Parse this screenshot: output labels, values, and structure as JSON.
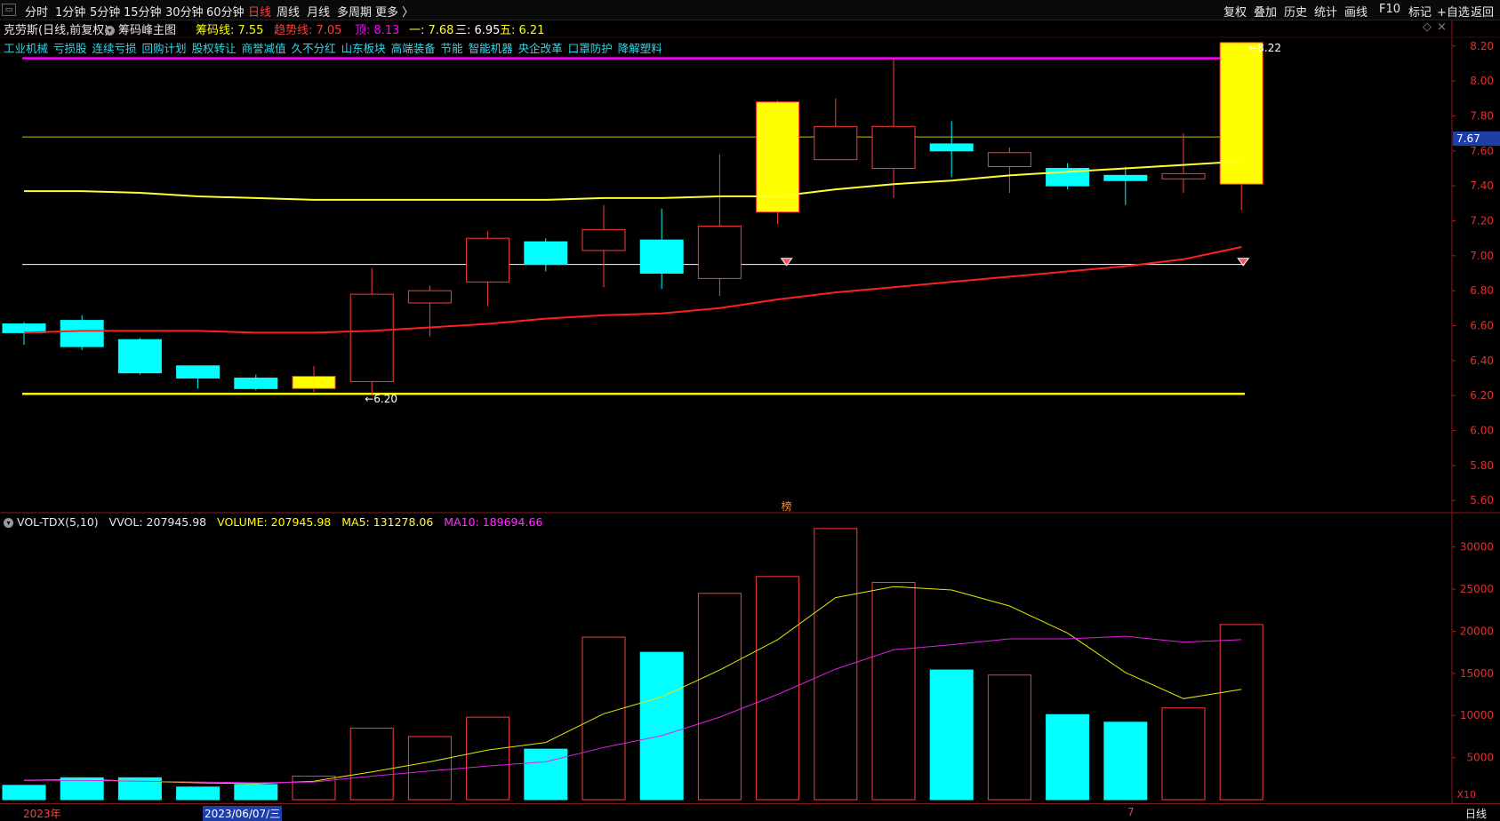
{
  "toolbar": {
    "periods": [
      "分时",
      "1分钟",
      "5分钟",
      "15分钟",
      "30分钟",
      "60分钟",
      "日线",
      "周线",
      "月线",
      "多周期",
      "更多 〉"
    ],
    "active_period": "日线",
    "tools": [
      "复权",
      "叠加",
      "历史",
      "统计",
      "画线",
      "F10",
      "标记",
      "+自选",
      "返回"
    ]
  },
  "title": {
    "stock": "克劳斯(日线,前复权)",
    "indicator": "筹码峰主图",
    "chip_line": "筹码线: 7.55",
    "trend_line": "趋势线: 7.05",
    "top": "顶: 8.13",
    "one": "一: 7.68",
    "three": "三: 6.95",
    "five": "五: 6.21"
  },
  "concepts": [
    "工业机械",
    "亏损股",
    "连续亏损",
    "回购计划",
    "股权转让",
    "商誉减值",
    "久不分红",
    "山东板块",
    "高端装备",
    "节能",
    "智能机器",
    "央企改革",
    "口罩防护",
    "降解塑料"
  ],
  "price_axis": {
    "ticks": [
      "8.20",
      "8.00",
      "7.80",
      "7.60",
      "7.40",
      "7.20",
      "7.00",
      "6.80",
      "6.60",
      "6.40",
      "6.20",
      "6.00",
      "5.80",
      "5.60"
    ],
    "current_price": "7.67"
  },
  "annotations": {
    "high_label": "8.22",
    "low_label": "6.20",
    "bang_label": "榜"
  },
  "volume_title": {
    "name": "VOL-TDX(5,10)",
    "vvol": "VVOL: 207945.98",
    "volume": "VOLUME: 207945.98",
    "ma5": "MA5: 131278.06",
    "ma10": "MA10: 189694.66"
  },
  "volume_axis": {
    "ticks": [
      "30000",
      "25000",
      "20000",
      "15000",
      "10000",
      "5000"
    ],
    "multiplier": "X10"
  },
  "bottom": {
    "year": "2023年",
    "cursor_date": "2023/06/07/三",
    "month_mark": "7",
    "period": "日线"
  },
  "colors": {
    "up": "#ff3b3b",
    "down": "#00ffff",
    "chip": "#ffff00",
    "ma_yellow": "#ffff33",
    "ma_red": "#ff2020",
    "top_line": "#ff00ff",
    "line_one": "#c8c800",
    "line_three": "#ffffff",
    "line_five": "#ffff00"
  },
  "chart_data": {
    "type": "candlestick",
    "price_range": [
      5.54,
      8.26
    ],
    "candles": [
      {
        "o": 6.61,
        "h": 6.62,
        "l": 6.49,
        "c": 6.56,
        "color": "down"
      },
      {
        "o": 6.63,
        "h": 6.66,
        "l": 6.46,
        "c": 6.48,
        "color": "down"
      },
      {
        "o": 6.52,
        "h": 6.53,
        "l": 6.32,
        "c": 6.33,
        "color": "down"
      },
      {
        "o": 6.37,
        "h": 6.37,
        "l": 6.24,
        "c": 6.3,
        "color": "down"
      },
      {
        "o": 6.3,
        "h": 6.32,
        "l": 6.23,
        "c": 6.24,
        "color": "down"
      },
      {
        "o": 6.24,
        "h": 6.37,
        "l": 6.22,
        "c": 6.31,
        "color": "chip"
      },
      {
        "o": 6.28,
        "h": 6.93,
        "l": 6.2,
        "c": 6.78,
        "color": "up"
      },
      {
        "o": 6.73,
        "h": 6.83,
        "l": 6.54,
        "c": 6.8,
        "color": "up"
      },
      {
        "o": 6.85,
        "h": 7.14,
        "l": 6.71,
        "c": 7.1,
        "color": "up"
      },
      {
        "o": 7.08,
        "h": 7.1,
        "l": 6.91,
        "c": 6.95,
        "color": "down"
      },
      {
        "o": 7.03,
        "h": 7.29,
        "l": 6.82,
        "c": 7.15,
        "color": "up"
      },
      {
        "o": 7.09,
        "h": 7.27,
        "l": 6.81,
        "c": 6.9,
        "color": "down"
      },
      {
        "o": 6.87,
        "h": 7.58,
        "l": 6.77,
        "c": 7.17,
        "color": "up"
      },
      {
        "o": 7.25,
        "h": 7.89,
        "l": 7.18,
        "c": 7.88,
        "color": "chip_up"
      },
      {
        "o": 7.55,
        "h": 7.9,
        "l": 7.55,
        "c": 7.74,
        "color": "up"
      },
      {
        "o": 7.5,
        "h": 8.13,
        "l": 7.33,
        "c": 7.74,
        "color": "up"
      },
      {
        "o": 7.64,
        "h": 7.77,
        "l": 7.45,
        "c": 7.6,
        "color": "down"
      },
      {
        "o": 7.51,
        "h": 7.62,
        "l": 7.36,
        "c": 7.59,
        "color": "up"
      },
      {
        "o": 7.5,
        "h": 7.53,
        "l": 7.38,
        "c": 7.4,
        "color": "down"
      },
      {
        "o": 7.46,
        "h": 7.51,
        "l": 7.29,
        "c": 7.43,
        "color": "down"
      },
      {
        "o": 7.44,
        "h": 7.7,
        "l": 7.36,
        "c": 7.47,
        "color": "up"
      },
      {
        "o": 7.41,
        "h": 8.22,
        "l": 7.26,
        "c": 8.22,
        "color": "chip_up"
      }
    ],
    "ma_yellow": [
      7.37,
      7.37,
      7.36,
      7.34,
      7.33,
      7.32,
      7.32,
      7.32,
      7.32,
      7.32,
      7.33,
      7.33,
      7.34,
      7.34,
      7.38,
      7.41,
      7.43,
      7.46,
      7.48,
      7.5,
      7.52,
      7.54
    ],
    "ma_red": [
      6.56,
      6.57,
      6.57,
      6.57,
      6.56,
      6.56,
      6.57,
      6.59,
      6.61,
      6.64,
      6.66,
      6.67,
      6.7,
      6.75,
      6.79,
      6.82,
      6.85,
      6.88,
      6.91,
      6.94,
      6.98,
      7.05
    ],
    "levels": {
      "top": 8.13,
      "one": 7.68,
      "three": 6.95,
      "five": 6.21
    },
    "volume_range": [
      0,
      32500
    ],
    "volume": [
      {
        "v": 1700,
        "color": "down"
      },
      {
        "v": 2600,
        "color": "down"
      },
      {
        "v": 2600,
        "color": "down"
      },
      {
        "v": 1500,
        "color": "down"
      },
      {
        "v": 1800,
        "color": "down"
      },
      {
        "v": 2800,
        "color": "up"
      },
      {
        "v": 8500,
        "color": "up"
      },
      {
        "v": 7500,
        "color": "up"
      },
      {
        "v": 9800,
        "color": "up"
      },
      {
        "v": 6000,
        "color": "down"
      },
      {
        "v": 19300,
        "color": "up"
      },
      {
        "v": 17500,
        "color": "down"
      },
      {
        "v": 24500,
        "color": "up"
      },
      {
        "v": 26500,
        "color": "up"
      },
      {
        "v": 32200,
        "color": "up"
      },
      {
        "v": 25800,
        "color": "up"
      },
      {
        "v": 15400,
        "color": "down"
      },
      {
        "v": 14800,
        "color": "up"
      },
      {
        "v": 10100,
        "color": "down"
      },
      {
        "v": 9200,
        "color": "down"
      },
      {
        "v": 10900,
        "color": "up"
      },
      {
        "v": 20800,
        "color": "up"
      }
    ],
    "vol_ma5": [
      2300,
      2400,
      2200,
      2000,
      1900,
      2200,
      3300,
      4500,
      5900,
      6800,
      10200,
      12200,
      15400,
      19000,
      24000,
      25300,
      24900,
      23000,
      19800,
      15100,
      12000,
      13100
    ],
    "vol_ma10": [
      2300,
      2300,
      2200,
      2100,
      2000,
      2100,
      2800,
      3400,
      4000,
      4500,
      6200,
      7600,
      9800,
      12500,
      15500,
      17800,
      18400,
      19100,
      19100,
      19400,
      18700,
      19000
    ]
  }
}
